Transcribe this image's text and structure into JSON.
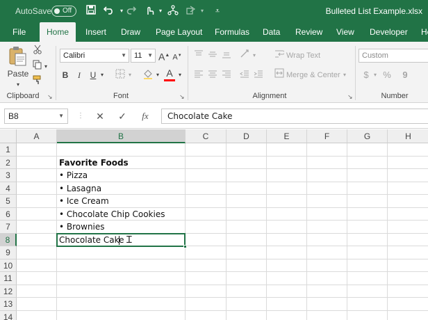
{
  "titlebar": {
    "autosave_label": "AutoSave",
    "autosave_state": "Off",
    "file_title": "Bulleted List Example.xlsx",
    "icons": [
      "save-icon",
      "undo-icon",
      "redo-icon",
      "touch-mode-icon",
      "share-icon",
      "shapes-icon",
      "customize-icon"
    ]
  },
  "tabs": [
    {
      "label": "File"
    },
    {
      "label": "Home",
      "active": true
    },
    {
      "label": "Insert"
    },
    {
      "label": "Draw"
    },
    {
      "label": "Page Layout"
    },
    {
      "label": "Formulas"
    },
    {
      "label": "Data"
    },
    {
      "label": "Review"
    },
    {
      "label": "View"
    },
    {
      "label": "Developer"
    },
    {
      "label": "He"
    }
  ],
  "ribbon": {
    "clipboard": {
      "label": "Clipboard",
      "paste_label": "Paste"
    },
    "font": {
      "label": "Font",
      "font_name": "Calibri",
      "font_size": "11",
      "bold": "B",
      "italic": "I",
      "underline": "U",
      "grow": "A",
      "shrink": "A",
      "font_color": "A",
      "font_color_swatch": "#ff0000"
    },
    "alignment": {
      "label": "Alignment",
      "wrap_text": "Wrap Text",
      "merge_center": "Merge & Center"
    },
    "number": {
      "label": "Number",
      "format": "Custom",
      "currency": "$",
      "percent": "%",
      "comma": "9"
    }
  },
  "formula_bar": {
    "name_box": "B8",
    "fx": "fx",
    "content": "Chocolate Cake"
  },
  "grid": {
    "columns": [
      "A",
      "B",
      "C",
      "D",
      "E",
      "F",
      "G",
      "H"
    ],
    "selected_column": "B",
    "rows": [
      "1",
      "2",
      "3",
      "4",
      "5",
      "6",
      "7",
      "8",
      "9",
      "10",
      "11",
      "12",
      "13",
      "14"
    ],
    "selected_row": "8",
    "cells": [
      {
        "ref": "B2",
        "text": "Favorite Foods",
        "bold": true
      },
      {
        "ref": "B3",
        "text": "• Pizza"
      },
      {
        "ref": "B4",
        "text": "• Lasagna"
      },
      {
        "ref": "B5",
        "text": "• Ice Cream"
      },
      {
        "ref": "B6",
        "text": "• Chocolate Chip Cookies"
      },
      {
        "ref": "B7",
        "text": "• Brownies"
      }
    ],
    "active_cell": {
      "ref": "B8",
      "text": "Chocolate Cake"
    }
  },
  "colors": {
    "accent": "#217346",
    "ribbon_bg": "#f3f3f3",
    "header_bg": "#efefef",
    "gridline": "#dadada"
  }
}
